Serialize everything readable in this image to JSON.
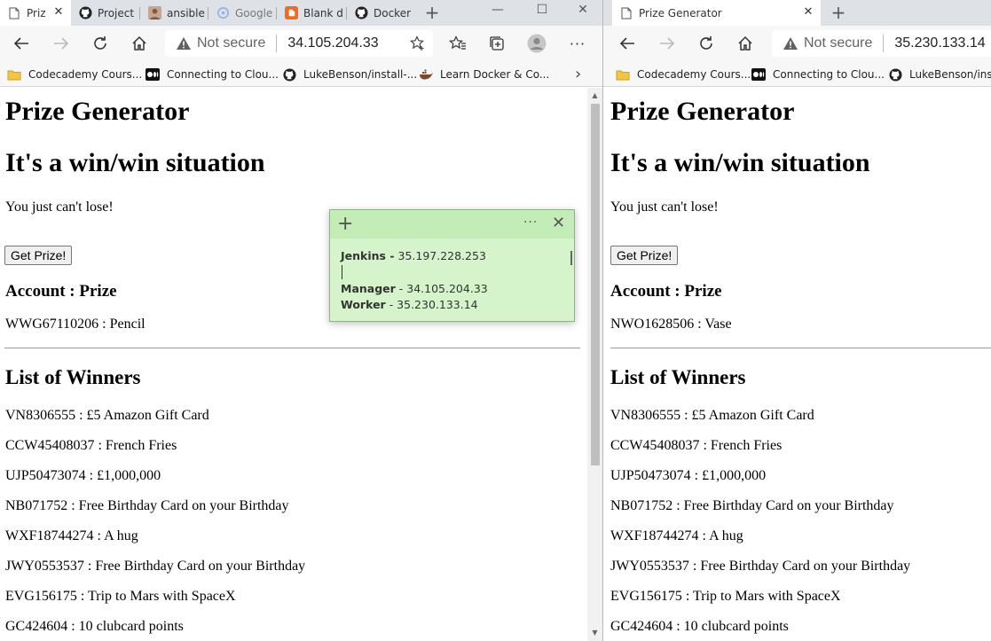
{
  "left_window": {
    "tabs": [
      {
        "label": "Priz",
        "icon": "page-icon",
        "active": true
      },
      {
        "label": "Project",
        "icon": "github-icon"
      },
      {
        "label": "ansible",
        "icon": "avatar-icon"
      },
      {
        "label": "Google",
        "icon": "google-icon"
      },
      {
        "label": "Blank d",
        "icon": "blank-doc-icon"
      },
      {
        "label": "Docker",
        "icon": "github-icon"
      }
    ],
    "address": {
      "not_secure": "Not secure",
      "url": "34.105.204.33"
    },
    "bookmarks": [
      {
        "label": "Codecademy Cours...",
        "icon": "folder-icon"
      },
      {
        "label": "Connecting to Clou...",
        "icon": "medium-icon"
      },
      {
        "label": "LukeBenson/install-...",
        "icon": "github-icon"
      },
      {
        "label": "Learn Docker & Co...",
        "icon": "docker-icon"
      }
    ],
    "page": {
      "title": "Prize Generator",
      "subtitle": "It's a win/win situation",
      "tagline": "You just can't lose!",
      "button": "Get Prize!",
      "account_header": "Account : Prize",
      "account_result": "WWG67110206 : Pencil",
      "winners_header": "List of Winners",
      "winners": [
        "VN8306555 : £5 Amazon Gift Card",
        "CCW45408037 : French Fries",
        "UJP50473074 : £1,000,000",
        "NB071752 : Free Birthday Card on your Birthday",
        "WXF18744274 : A hug",
        "JWY0553537 : Free Birthday Card on your Birthday",
        "EVG156175 : Trip to Mars with SpaceX",
        "GC424604 : 10 clubcard points"
      ]
    }
  },
  "right_window": {
    "tabs": [
      {
        "label": "Prize Generator",
        "icon": "page-icon",
        "active": true
      }
    ],
    "address": {
      "not_secure": "Not secure",
      "url": "35.230.133.14"
    },
    "bookmarks": [
      {
        "label": "Codecademy Cours...",
        "icon": "folder-icon"
      },
      {
        "label": "Connecting to Clou...",
        "icon": "medium-icon"
      },
      {
        "label": "LukeBenson/insta",
        "icon": "github-icon"
      }
    ],
    "page": {
      "title": "Prize Generator",
      "subtitle": "It's a win/win situation",
      "tagline": "You just can't lose!",
      "button": "Get Prize!",
      "account_header": "Account : Prize",
      "account_result": "NWO1628506 : Vase",
      "winners_header": "List of Winners",
      "winners": [
        "VN8306555 : £5 Amazon Gift Card",
        "CCW45408037 : French Fries",
        "UJP50473074 : £1,000,000",
        "NB071752 : Free Birthday Card on your Birthday",
        "WXF18744274 : A hug",
        "JWY0553537 : Free Birthday Card on your Birthday",
        "EVG156175 : Trip to Mars with SpaceX",
        "GC424604 : 10 clubcard points"
      ]
    }
  },
  "sticky_note": {
    "lines": [
      {
        "label": "Jenkins -",
        "value": " 35.197.228.253"
      },
      {
        "label": "Manager",
        "value": " - 34.105.204.33"
      },
      {
        "label": "Worker",
        "value": " - 35.230.133.14"
      }
    ],
    "colors": {
      "body": "#d6f4cc",
      "header": "#c4ecb6"
    }
  }
}
